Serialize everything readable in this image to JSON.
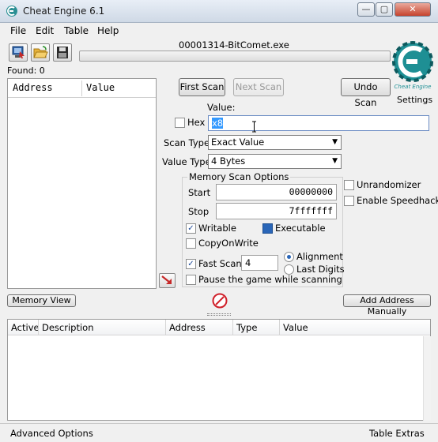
{
  "window": {
    "title": "Cheat Engine 6.1",
    "min": "—",
    "max": "▢",
    "close": "✕"
  },
  "menu": [
    "File",
    "Edit",
    "Table",
    "Help"
  ],
  "process": {
    "name": "00001314-BitComet.exe",
    "progress": 0
  },
  "found": "Found: 0",
  "settings_label": "Settings",
  "logo_caption": "Cheat Engine",
  "address_list": {
    "col_address": "Address",
    "col_value": "Value"
  },
  "buttons": {
    "first_scan": "First Scan",
    "next_scan": "Next Scan",
    "undo_scan": "Undo Scan",
    "memory_view": "Memory View",
    "add_address": "Add Address Manually"
  },
  "scan": {
    "value_label": "Value:",
    "hex_label": "Hex",
    "value_input": "x8",
    "scan_type_label": "Scan Type",
    "scan_type": "Exact Value",
    "value_type_label": "Value Type",
    "value_type": "4 Bytes"
  },
  "memory": {
    "title": "Memory Scan Options",
    "start_label": "Start",
    "start_value": "00000000",
    "stop_label": "Stop",
    "stop_value": "7fffffff",
    "writable": "Writable",
    "executable": "Executable",
    "copyonwrite": "CopyOnWrite",
    "fast_scan": "Fast Scan",
    "fast_scan_value": "4",
    "alignment": "Alignment",
    "last_digits": "Last Digits",
    "pause": "Pause the game while scanning"
  },
  "options": {
    "unrandomizer": "Unrandomizer",
    "speedhack": "Enable Speedhack"
  },
  "results": {
    "cols": [
      "Active",
      "Description",
      "Address",
      "Type",
      "Value"
    ]
  },
  "status": {
    "left": "Advanced Options",
    "right": "Table Extras"
  },
  "colors": {
    "progress_fill": "#5cc35c",
    "logo": "#1e8f94",
    "stop_icon": "#d0202a"
  }
}
